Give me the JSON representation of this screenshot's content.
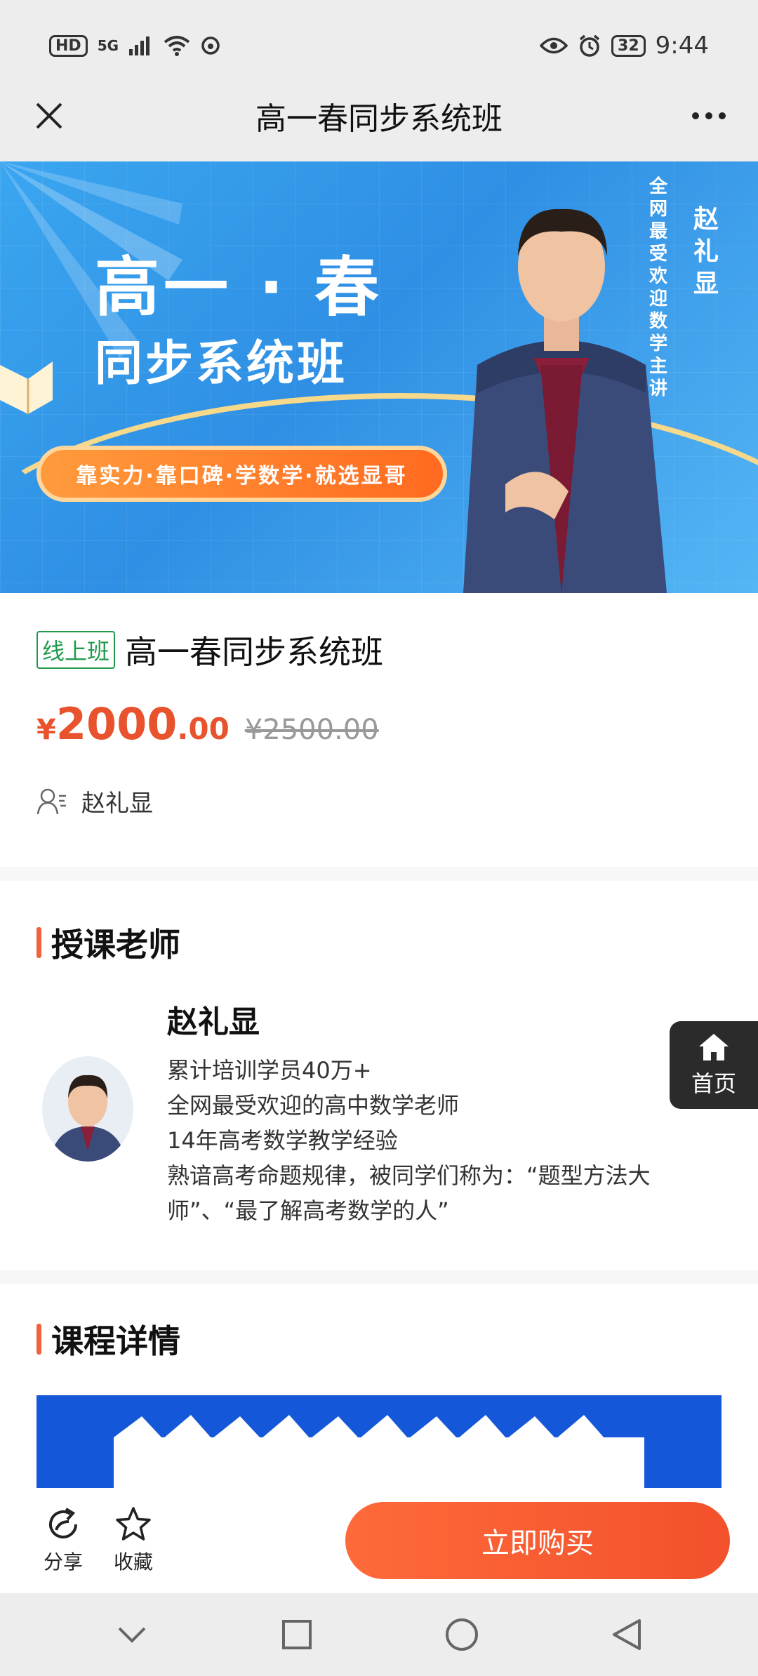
{
  "status_bar": {
    "left_chip": "HD",
    "signal_label": "5G",
    "battery": "32",
    "time": "9:44"
  },
  "navbar": {
    "title": "高一春同步系统班"
  },
  "banner": {
    "title": "高一 · 春",
    "subtitle": "同步系统班",
    "slogan": "靠实力·靠口碑·学数学·就选显哥",
    "teacher_name": "赵礼显",
    "tagline": "全网最受欢迎数学主讲"
  },
  "course": {
    "badge": "线上班",
    "title": "高一春同步系统班",
    "price_currency": "¥",
    "price_integer": "2000",
    "price_decimal": ".00",
    "original_price": "¥2500.00",
    "teacher": "赵礼显"
  },
  "teacher_section": {
    "heading": "授课老师",
    "name": "赵礼显",
    "lines": [
      "累计培训学员40万+",
      "全网最受欢迎的高中数学老师",
      "14年高考数学教学经验",
      "熟谙高考命题规律，被同学们称为：“题型方法大师”、“最了解高考数学的人”"
    ]
  },
  "float_home": {
    "label": "首页"
  },
  "details_section": {
    "heading": "课程详情"
  },
  "action_bar": {
    "share_label": "分享",
    "favorite_label": "收藏",
    "buy_label": "立即购买"
  },
  "colors": {
    "accent": "#f0623e",
    "price": "#e8522d",
    "badge_green": "#1f9a4c",
    "banner_blue": "#2f8fe4"
  }
}
